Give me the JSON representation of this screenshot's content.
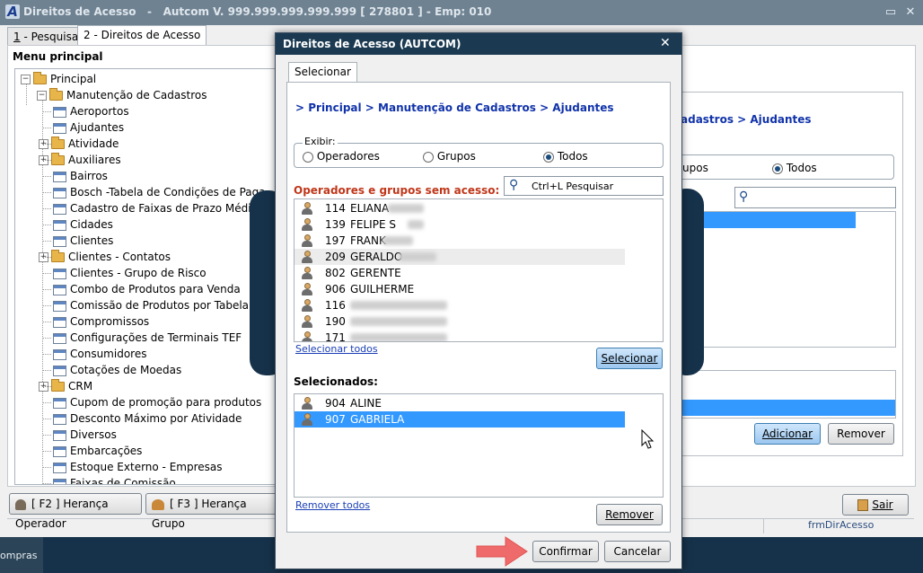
{
  "window": {
    "title": "Direitos de Acesso   -   Autcom V. 999.999.999.999.999 [ 278801 ] - Emp: 010",
    "app_icon": "A",
    "tabs": [
      {
        "num": "1",
        "label": " - Pesquisar"
      },
      {
        "num": "2",
        "label": " - Direitos de Acesso"
      }
    ]
  },
  "menu": {
    "title": "Menu principal",
    "root": "Principal",
    "group": "Manutenção de Cadastros",
    "items": [
      {
        "label": "Aeroportos",
        "type": "page"
      },
      {
        "label": "Ajudantes",
        "type": "page"
      },
      {
        "label": "Atividade",
        "type": "folder"
      },
      {
        "label": "Auxiliares",
        "type": "folder"
      },
      {
        "label": "Bairros",
        "type": "page"
      },
      {
        "label": "Bosch -Tabela de Condições de Paga",
        "type": "page"
      },
      {
        "label": "Cadastro de Faixas de Prazo Médio",
        "type": "page"
      },
      {
        "label": "Cidades",
        "type": "page"
      },
      {
        "label": "Clientes",
        "type": "page"
      },
      {
        "label": "Clientes - Contatos",
        "type": "folder"
      },
      {
        "label": "Clientes - Grupo de Risco",
        "type": "page"
      },
      {
        "label": "Combo de Produtos para Venda",
        "type": "page"
      },
      {
        "label": "Comissão de Produtos por Tabela",
        "type": "page"
      },
      {
        "label": "Compromissos",
        "type": "page"
      },
      {
        "label": "Configurações de Terminais TEF",
        "type": "page"
      },
      {
        "label": "Consumidores",
        "type": "page"
      },
      {
        "label": "Cotações de Moedas",
        "type": "page"
      },
      {
        "label": "CRM",
        "type": "folder"
      },
      {
        "label": "Cupom de promoção para produtos",
        "type": "page"
      },
      {
        "label": "Desconto Máximo por Atividade",
        "type": "page"
      },
      {
        "label": "Diversos",
        "type": "page"
      },
      {
        "label": "Embarcações",
        "type": "page"
      },
      {
        "label": "Estoque Externo - Empresas",
        "type": "page"
      },
      {
        "label": "Faixas de Comissão",
        "type": "page"
      }
    ]
  },
  "bottom_bar": {
    "heranca_operador": "[ F2 ] Herança Operador",
    "heranca_grupo": "[ F3 ] Herança Grupo",
    "sair": "Sair",
    "form_name": "frmDirAcesso"
  },
  "bg_panel": {
    "breadcrumb_fragment": "adastros > Ajudantes",
    "radio_fragment": "upos",
    "radio_todos": "Todos",
    "adicionar": "Adicionar",
    "remover": "Remover"
  },
  "taskbar": {
    "item": "ompras"
  },
  "dialog": {
    "title": "Direitos de Acesso (AUTCOM)",
    "tab": "Selecionar",
    "breadcrumb": "> Principal > Manutenção de Cadastros > Ajudantes",
    "exibir_label": "Exibir:",
    "radios": [
      {
        "label": "Operadores",
        "checked": false
      },
      {
        "label": "Grupos",
        "checked": false
      },
      {
        "label": "Todos",
        "checked": true
      }
    ],
    "sem_acesso_title": "Operadores e grupos sem acesso:",
    "search_placeholder": "Ctrl+L Pesquisar",
    "sem_acesso": [
      {
        "code": "114",
        "name": "ELIANA"
      },
      {
        "code": "139",
        "name": "FELIPE S"
      },
      {
        "code": "197",
        "name": "FRANK"
      },
      {
        "code": "209",
        "name": "GERALDO"
      },
      {
        "code": "802",
        "name": "GERENTE"
      },
      {
        "code": "906",
        "name": "GUILHERME"
      },
      {
        "code": "116",
        "name": ""
      },
      {
        "code": "190",
        "name": ""
      },
      {
        "code": "171",
        "name": ""
      }
    ],
    "selecionar_todos": "Selecionar todos",
    "selecionar": "Selecionar",
    "selecionados_title": "Selecionados:",
    "selecionados": [
      {
        "code": "904",
        "name": "ALINE"
      },
      {
        "code": "907",
        "name": "GABRIELA"
      }
    ],
    "remover_todos": "Remover todos",
    "remover": "Remover",
    "confirmar": "Confirmar",
    "cancelar": "Cancelar"
  }
}
